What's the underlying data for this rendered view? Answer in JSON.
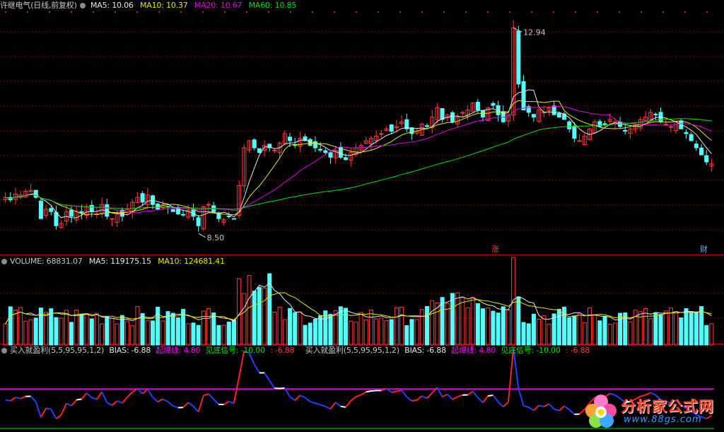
{
  "legend_price": {
    "title": "许继电气(日线,前复权)",
    "ma5": "MA5: 10.06",
    "ma10": "MA10: 10.37",
    "ma20": "MA20: 10.67",
    "ma60": "MA60: 10.85"
  },
  "legend_volume": {
    "title": "VOLUME: 68831.07",
    "ma5": "MA5: 119175.15",
    "ma10": "MA10: 124681.41"
  },
  "legend_indicator": {
    "title1": "买入就盈利(5,5,95,95,1,2)",
    "bias1": "BIAS: -6.88",
    "qibao1": "起爆线: 4.80",
    "jiandi1": "见底信号: -10.00",
    "val1": ": -6.88",
    "title2": "买入就盈利(5,5,95,95,1,2)",
    "bias2": "BIAS: -6.88",
    "qibao2": "起爆线: 4.80",
    "jiandi2": "见底信号: -10.00",
    "val2": ": -6.88"
  },
  "markers": {
    "high": "12.94",
    "low": "8.50",
    "zhang": "涨",
    "cai": "财"
  },
  "watermark": {
    "title": "分析家公式网",
    "url": "www.88gs.com"
  },
  "colors": {
    "up": "#ff3c3c",
    "down": "#54ffff",
    "ma5": "#e8e8e8",
    "ma10": "#e8e800",
    "ma20": "#e000e0",
    "ma60": "#00e000",
    "grid": "#8b0000",
    "qibao": "#ff00ff",
    "jiandi": "#00e000",
    "bias_up": "#ff2020",
    "bias_down": "#2040ff",
    "bias_flat": "#ffffff"
  },
  "chart_data": [
    {
      "type": "candlestick",
      "title": "许继电气(日线,前复权)",
      "price_high_label": 12.94,
      "price_low_label": 8.5,
      "ylim": [
        8.2,
        13.2
      ],
      "close": [
        9.35,
        9.3,
        9.42,
        9.4,
        9.48,
        9.5,
        9.35,
        8.9,
        9.1,
        9.05,
        8.75,
        8.8,
        9.05,
        8.95,
        9.05,
        9.02,
        9.15,
        9.05,
        9.0,
        9.2,
        8.95,
        8.9,
        9.0,
        8.95,
        9.1,
        9.25,
        9.35,
        9.25,
        9.4,
        9.2,
        9.1,
        9.2,
        9.15,
        9.05,
        9.0,
        8.98,
        9.08,
        8.95,
        8.75,
        9.15,
        9.2,
        9.05,
        8.9,
        8.88,
        8.95,
        8.9,
        9.6,
        10.4,
        10.55,
        10.4,
        10.3,
        10.45,
        10.4,
        10.35,
        10.5,
        10.7,
        10.55,
        10.45,
        10.6,
        10.55,
        10.45,
        10.4,
        10.35,
        10.3,
        10.2,
        10.35,
        10.2,
        10.15,
        10.3,
        10.4,
        10.45,
        10.55,
        10.6,
        10.65,
        10.7,
        10.8,
        10.75,
        10.85,
        10.95,
        10.8,
        10.7,
        10.75,
        10.9,
        10.85,
        11.05,
        11.25,
        11.0,
        11.1,
        10.95,
        11.05,
        11.15,
        11.2,
        11.35,
        11.2,
        11.05,
        11.25,
        11.3,
        11.1,
        10.95,
        11.1,
        12.94,
        11.75,
        11.2,
        11.15,
        11.05,
        11.2,
        11.15,
        11.25,
        11.1,
        11.05,
        11.0,
        10.8,
        10.6,
        10.55,
        10.65,
        10.8,
        10.95,
        10.85,
        10.9,
        11.0,
        10.95,
        10.85,
        10.75,
        10.8,
        10.9,
        11.0,
        11.05,
        11.15,
        11.1,
        10.95,
        10.9,
        10.85,
        10.95,
        10.8,
        10.7,
        10.55,
        10.4,
        10.25,
        10.1,
        10.06
      ],
      "ma5_last": 10.06,
      "ma10_last": 10.37,
      "ma20_last": 10.67,
      "ma60_last": 10.85
    },
    {
      "type": "bar",
      "title": "VOLUME: 68831.07",
      "volume_last": 68831.07,
      "ma5_last": 119175.15,
      "ma10_last": 124681.41
    },
    {
      "type": "line",
      "title": "买入就盈利(5,5,95,95,1,2)",
      "bias_last": -6.88,
      "qibao": 4.8,
      "jiandi": -10.0
    }
  ]
}
